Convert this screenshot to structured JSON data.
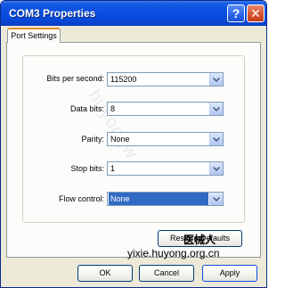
{
  "window": {
    "title": "COM3 Properties",
    "help_symbol": "?",
    "close_symbol": "✕"
  },
  "tabs": [
    {
      "label": "Port Settings",
      "selected": true
    }
  ],
  "settings": [
    {
      "id": "bits-per-second",
      "label": "Bits per second:",
      "value": "115200"
    },
    {
      "id": "data-bits",
      "label": "Data bits:",
      "value": "8"
    },
    {
      "id": "parity",
      "label": "Parity:",
      "value": "None"
    },
    {
      "id": "stop-bits",
      "label": "Stop bits:",
      "value": "1"
    },
    {
      "id": "flow-control",
      "label": "Flow control:",
      "value": "None"
    }
  ],
  "buttons": {
    "restore_defaults": "Restore Defaults",
    "ok": "OK",
    "cancel": "Cancel",
    "apply": "Apply"
  },
  "overlay": {
    "watermark": "huyongw",
    "stamp": "医械人",
    "site": "yixie.huyong.org.cn"
  },
  "colors": {
    "titlebar": "#0a4fe0",
    "selection": "#316ac5",
    "tab_accent": "#e68b2c"
  },
  "icons": {
    "dropdown": "chevron-down-icon"
  }
}
